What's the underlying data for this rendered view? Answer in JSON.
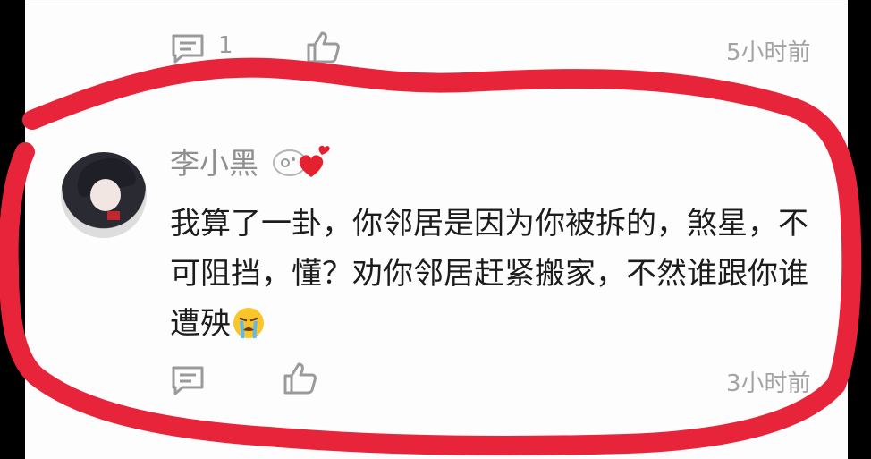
{
  "previous_comment": {
    "reply_count": "1",
    "time": "5小时前",
    "icons": [
      "comment-icon",
      "like-icon"
    ]
  },
  "comment": {
    "username": "李小黑",
    "badge_icon": "heart-badge-icon",
    "text": "我算了一卦，你邻居是因为你被拆的，煞星，不可阻挡，懂？劝你邻居赶紧搬家，不然谁跟你谁遭殃",
    "emoji": "crying-face-emoji",
    "time": "3小时前",
    "icons": [
      "comment-icon",
      "like-icon"
    ]
  },
  "colors": {
    "annotation_red": "#e8243a",
    "meta_gray": "#9a9a9a",
    "text": "#1c1c1c"
  }
}
